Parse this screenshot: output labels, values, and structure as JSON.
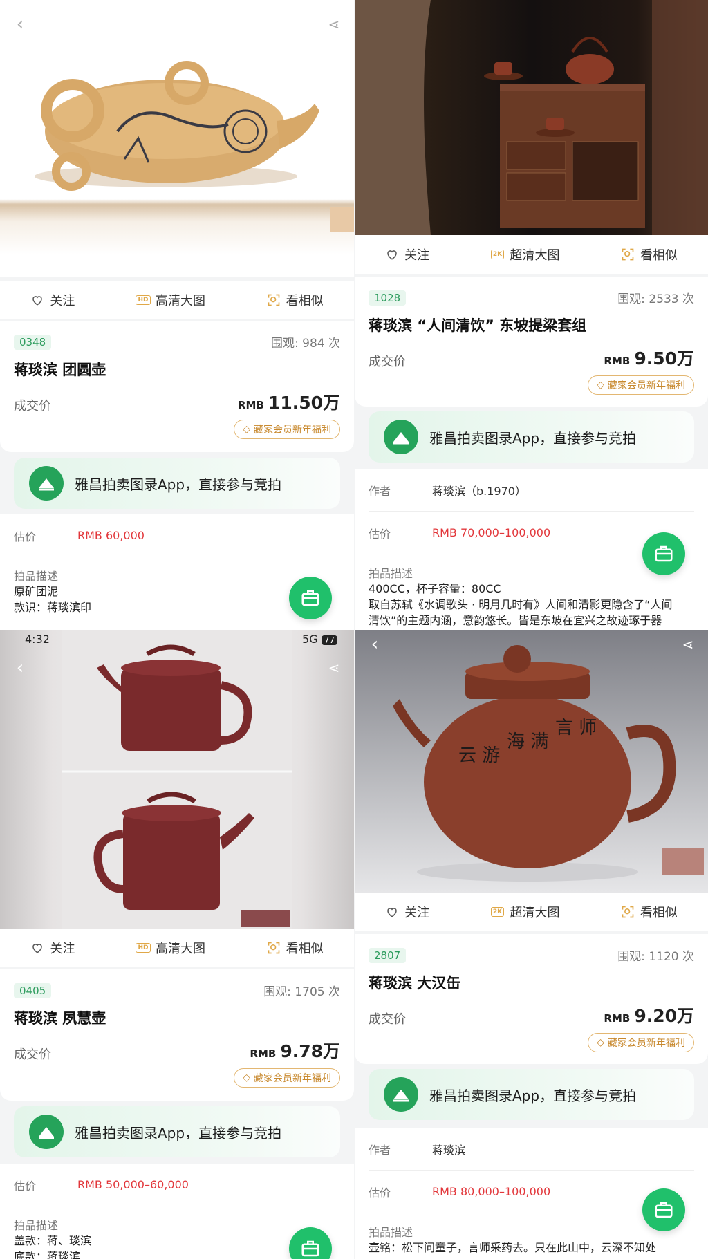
{
  "actions": {
    "follow": "关注",
    "hd_image": "高清大图",
    "uhd_image": "超清大图",
    "similar": "看相似"
  },
  "common": {
    "deal_label": "成交价",
    "currency": "RMB",
    "promo": "藏家会员新年福利",
    "banner": "雅昌拍卖图录App，直接参与竞拍",
    "author_label": "作者",
    "estimate_label": "估价",
    "desc_label": "拍品描述",
    "views_prefix": "围观:",
    "views_suffix": "次"
  },
  "colors": {
    "accent_green": "#20c06b",
    "estimate_red": "#e2373b",
    "promo_gold": "#c8892e"
  },
  "lots": [
    {
      "lot": "0348",
      "views": "984",
      "title": "蒋琰滨 团圆壶",
      "price": "11.50万",
      "estimate": "RMB  60,000",
      "desc_lines": [
        "原矿团泥",
        "款识：蒋琰滨印"
      ]
    },
    {
      "lot": "1028",
      "views": "2533",
      "title": "蒋琰滨 “人间清饮” 东坡提梁套组",
      "price": "9.50万",
      "author": "蒋琰滨（b.1970）",
      "estimate": "RMB  70,000–100,000",
      "desc_lines": [
        "400CC，杯子容量：80CC",
        "取自苏轼《水调歌头 · 明月几时有》人间和清影更隐含了“人间",
        "清饮”的主题内涵，意韵悠长。皆是东坡在宜兴之故迹琢于器"
      ]
    },
    {
      "lot": "0405",
      "views": "1705",
      "title": "蒋琰滨 夙慧壶",
      "price": "9.78万",
      "estimate": "RMB  50,000–60,000",
      "desc_lines": [
        "盖款：蒋、琰滨",
        "底款：蒋琰滨"
      ]
    },
    {
      "lot": "2807",
      "views": "1120",
      "title": "蒋琰滨 大汉缶",
      "price": "9.20万",
      "author": "蒋琰滨",
      "estimate": "RMB  80,000–100,000",
      "desc_lines": [
        "壶铭：松下问童子，言师采药去。只在此山中，云深不知处"
      ]
    }
  ],
  "status": {
    "time": "4:32",
    "signal": "5G",
    "battery": "77"
  }
}
